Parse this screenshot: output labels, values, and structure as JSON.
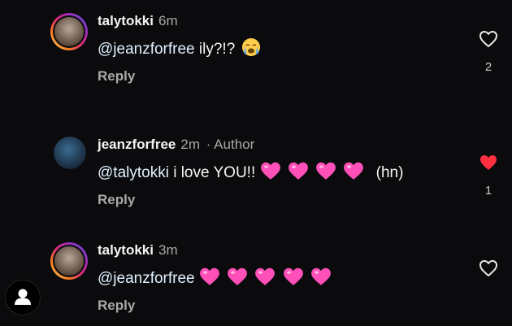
{
  "comments": [
    {
      "username": "talytokki",
      "time": "6m",
      "author_tag": "",
      "mention": "@jeanzforfree",
      "text": "ily?!?",
      "emoji": "crying-face",
      "heart_count": 0,
      "reply_label": "Reply",
      "like_count": "2",
      "liked": false
    },
    {
      "username": "jeanzforfree",
      "time": "2m",
      "author_tag": "· Author",
      "mention": "@talytokki",
      "text": "i love YOU!!",
      "emoji": "pink-heart",
      "heart_count": 4,
      "suffix": "(hn)",
      "reply_label": "Reply",
      "like_count": "1",
      "liked": true
    },
    {
      "username": "talytokki",
      "time": "3m",
      "author_tag": "",
      "mention": "@jeanzforfree",
      "text": "",
      "emoji": "pink-heart",
      "heart_count": 5,
      "reply_label": "Reply",
      "like_count": "",
      "liked": false
    }
  ],
  "colors": {
    "like_red": "#ff3040",
    "pink_heart": "#ff4fb8",
    "muted": "#a8a8a8"
  },
  "icons": {
    "profile": "person-icon",
    "like": "heart-outline-icon",
    "liked": "heart-filled-icon"
  }
}
